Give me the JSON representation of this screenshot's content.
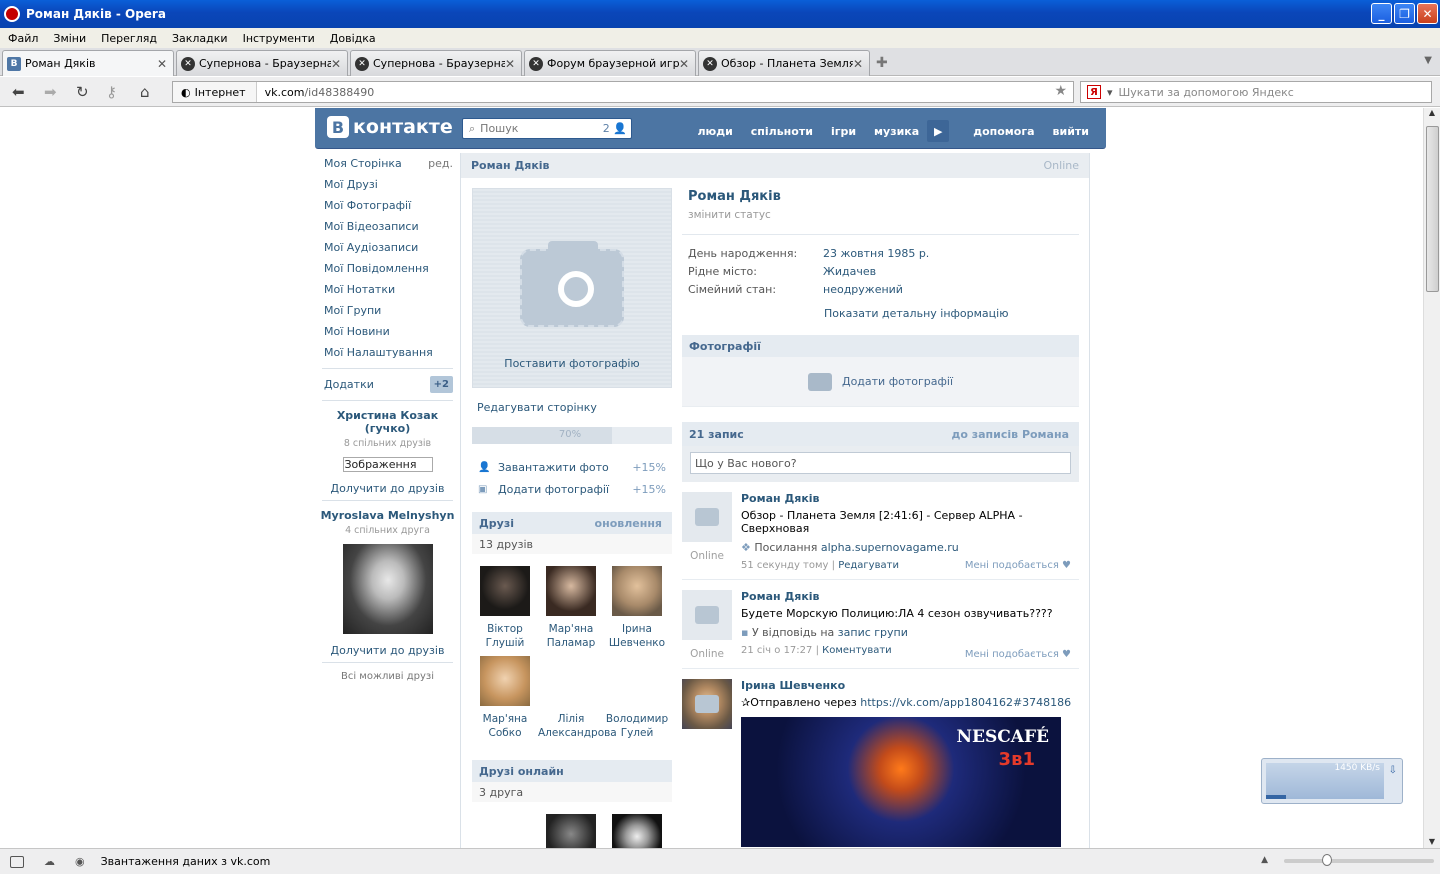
{
  "window": {
    "title": "Роман Дяків - Opera"
  },
  "menu": [
    "Файл",
    "Зміни",
    "Перегляд",
    "Закладки",
    "Інструменти",
    "Довідка"
  ],
  "tabs": [
    {
      "label": "Роман Дяків",
      "active": true,
      "icon": "vk-favicon"
    },
    {
      "label": "Супернова - Браузерна...",
      "active": false,
      "icon": "supernova-favicon"
    },
    {
      "label": "Супернова - Браузерна...",
      "active": false,
      "icon": "supernova-favicon"
    },
    {
      "label": "Форум браузерной игр...",
      "active": false,
      "icon": "supernova-favicon"
    },
    {
      "label": "Обзор - Планета Земля ...",
      "active": false,
      "icon": "supernova-favicon"
    }
  ],
  "address": {
    "security": "Інтернет",
    "domain": "vk.com",
    "path": "/id48388490"
  },
  "search": {
    "placeholder": "Шукати за допомогою Яндекс"
  },
  "vk": {
    "logo": "контакте",
    "search_placeholder": "Пошук",
    "search_count": "2",
    "nav": [
      "люди",
      "спільноти",
      "ігри",
      "музика",
      "допомога",
      "вийти"
    ]
  },
  "left_menu": {
    "items": [
      "Моя Сторінка",
      "Мої Друзі",
      "Мої Фотографії",
      "Мої Відеозаписи",
      "Мої Аудіозаписи",
      "Мої Повідомлення",
      "Мої Нотатки",
      "Мої Групи",
      "Мої Новини",
      "Мої Налаштування"
    ],
    "edit": "ред.",
    "apps": "Додатки",
    "apps_badge": "+2",
    "suggest1": {
      "name": "Христина Козак (гучко)",
      "mutual": "8 спільних друзів",
      "input_value": "Зображення",
      "add": "Долучити до друзів"
    },
    "suggest2": {
      "name": "Myroslava Melnyshyn",
      "mutual": "4 спільних друга",
      "add": "Долучити до друзів"
    },
    "all_friends": "Всі можливі друзі"
  },
  "profile": {
    "header_name": "Роман Дяків",
    "online": "Online",
    "name": "Роман Дяків",
    "status": "змінити статус",
    "info": [
      {
        "k": "День народження:",
        "v": "23 жовтня 1985 р."
      },
      {
        "k": "Рідне місто:",
        "v": "Жидачев"
      },
      {
        "k": "Сімейний стан:",
        "v": "неодружений"
      }
    ],
    "more": "Показати детальну інформацію",
    "set_photo": "Поставити фотографію",
    "edit_page": "Редагувати сторінку",
    "progress": "70%",
    "progress_value": 0.7,
    "tasks": [
      {
        "label": "Завантажити фото",
        "pct": "+15%",
        "icon": "user-icon"
      },
      {
        "label": "Додати фотографії",
        "pct": "+15%",
        "icon": "camera-icon"
      }
    ]
  },
  "friends": {
    "title": "Друзі",
    "updates": "оновлення",
    "count": "13 друзів",
    "list": [
      {
        "name": "Віктор Глушій"
      },
      {
        "name": "Мар'яна Паламар"
      },
      {
        "name": "Ірина Шевченко"
      },
      {
        "name": "Мар'яна Собко"
      },
      {
        "name": "Лілія Александрова"
      },
      {
        "name": "Володимир Гулей"
      }
    ]
  },
  "friends_online": {
    "title": "Друзі онлайн",
    "count": "3 друга"
  },
  "photos": {
    "title": "Фотографії",
    "add": "Додати фотографії"
  },
  "wall": {
    "count": "21 запис",
    "to_posts": "до записів Романа",
    "placeholder": "Що у Вас нового?",
    "posts": [
      {
        "author": "Роман Дяків",
        "text": "Обзор - Планета Земля [2:41:6] - Сервер ALPHA - Сверхновая",
        "link_label": "Посилання",
        "link": "alpha.supernovagame.ru",
        "time": "51 секунду тому",
        "action": "Редагувати",
        "like": "Мені подобається",
        "online": "Online"
      },
      {
        "author": "Роман Дяків",
        "text": "Будете Морскую Полицию:ЛА 4 сезон озвучивать????",
        "reply_label": "У відповідь на",
        "reply_link": "запис групи",
        "time": "21 січ о 17:27",
        "action": "Коментувати",
        "like": "Мені подобається",
        "online": "Online"
      },
      {
        "author": "Ірина Шевченко",
        "text_prefix": "✰Отправлено через",
        "text_link": "https://vk.com/app1804162#3748186",
        "image_brand": "NESCAFÉ",
        "image_sub": "3в1"
      }
    ]
  },
  "status": {
    "message": "Звантаження даних з vk.com"
  },
  "speed": {
    "value": "1450 KB/s"
  }
}
